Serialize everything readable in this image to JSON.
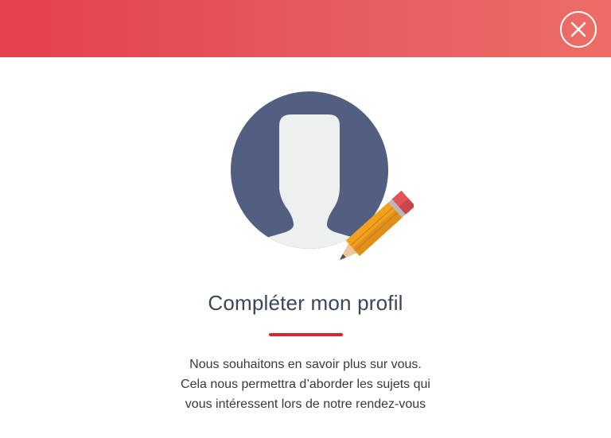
{
  "header": {
    "accent_color": "#e3414b",
    "close_icon": "close-circle-icon"
  },
  "illustration": {
    "avatar_icon": "user-avatar-icon",
    "pencil_icon": "pencil-icon",
    "avatar_bg_color": "#535f80"
  },
  "content": {
    "title": "Compléter mon profil",
    "underline_color": "#d9262e",
    "description_lines": [
      "Nous souhaitons en savoir plus sur vous.",
      "Cela nous permettra d’aborder les sujets qui",
      "vous intéressent lors de notre rendez-vous"
    ]
  }
}
